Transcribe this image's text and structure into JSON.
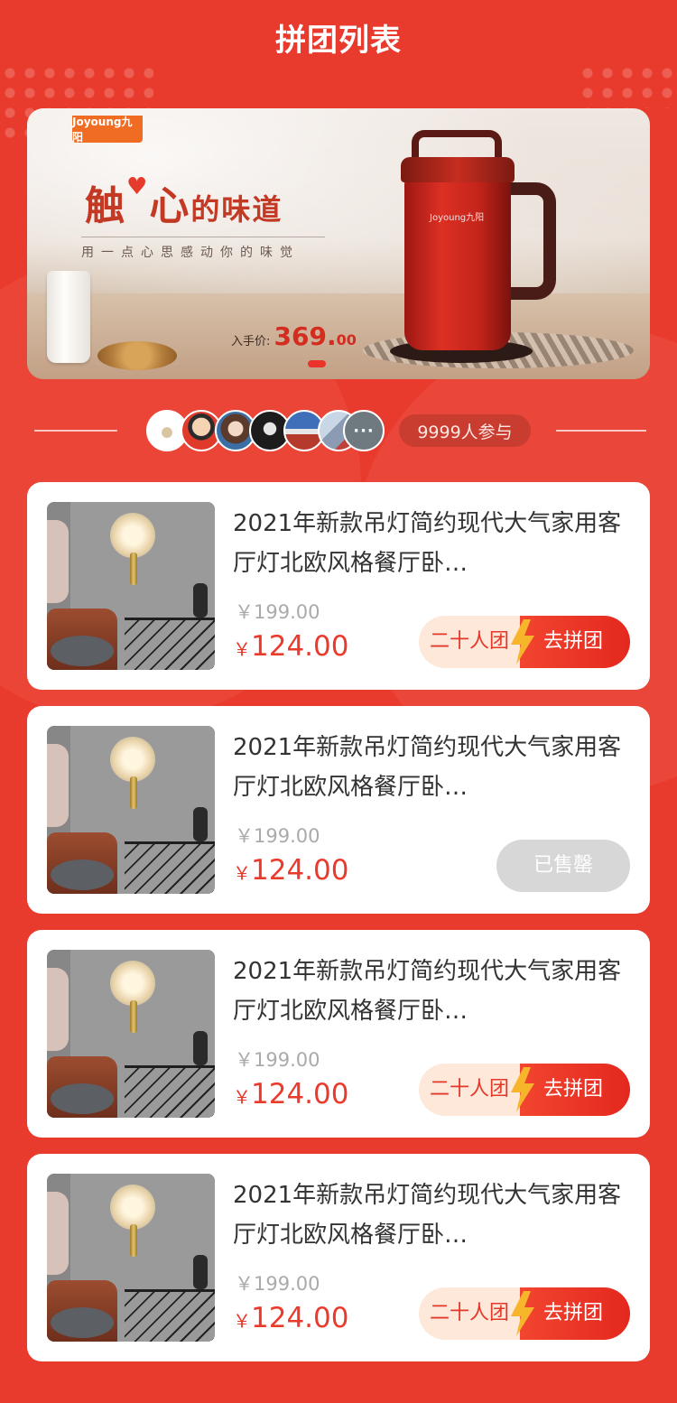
{
  "header": {
    "title": "拼团列表"
  },
  "banner": {
    "brand": "Joyoung九阳",
    "slogan_pre": "触",
    "slogan_heart": "♥",
    "slogan_mid": "心",
    "slogan_post": "的味道",
    "subtitle": "用一点心思感动你的味觉",
    "price_label": "入手价:",
    "price_int": "369.",
    "price_dec": "00",
    "kettle_logo": "Joyoung九阳"
  },
  "participants": {
    "more_label": "···",
    "count_text": "9999人参与"
  },
  "products": [
    {
      "name": "2021年新款吊灯简约现代大气家用客厅灯北欧风格餐厅卧…",
      "original_price": "￥199.00",
      "currency": "￥",
      "price": "124.00",
      "group_label": "二十人团",
      "action_label": "去拼团",
      "sold_out": false
    },
    {
      "name": "2021年新款吊灯简约现代大气家用客厅灯北欧风格餐厅卧…",
      "original_price": "￥199.00",
      "currency": "￥",
      "price": "124.00",
      "sold_label": "已售罄",
      "sold_out": true
    },
    {
      "name": "2021年新款吊灯简约现代大气家用客厅灯北欧风格餐厅卧…",
      "original_price": "￥199.00",
      "currency": "￥",
      "price": "124.00",
      "group_label": "二十人团",
      "action_label": "去拼团",
      "sold_out": false
    },
    {
      "name": "2021年新款吊灯简约现代大气家用客厅灯北欧风格餐厅卧…",
      "original_price": "￥199.00",
      "currency": "￥",
      "price": "124.00",
      "group_label": "二十人团",
      "action_label": "去拼团",
      "sold_out": false
    }
  ],
  "colors": {
    "accent": "#e93b2d",
    "group_bg": "#fde8d9",
    "sold_bg": "#d7d7d7"
  }
}
